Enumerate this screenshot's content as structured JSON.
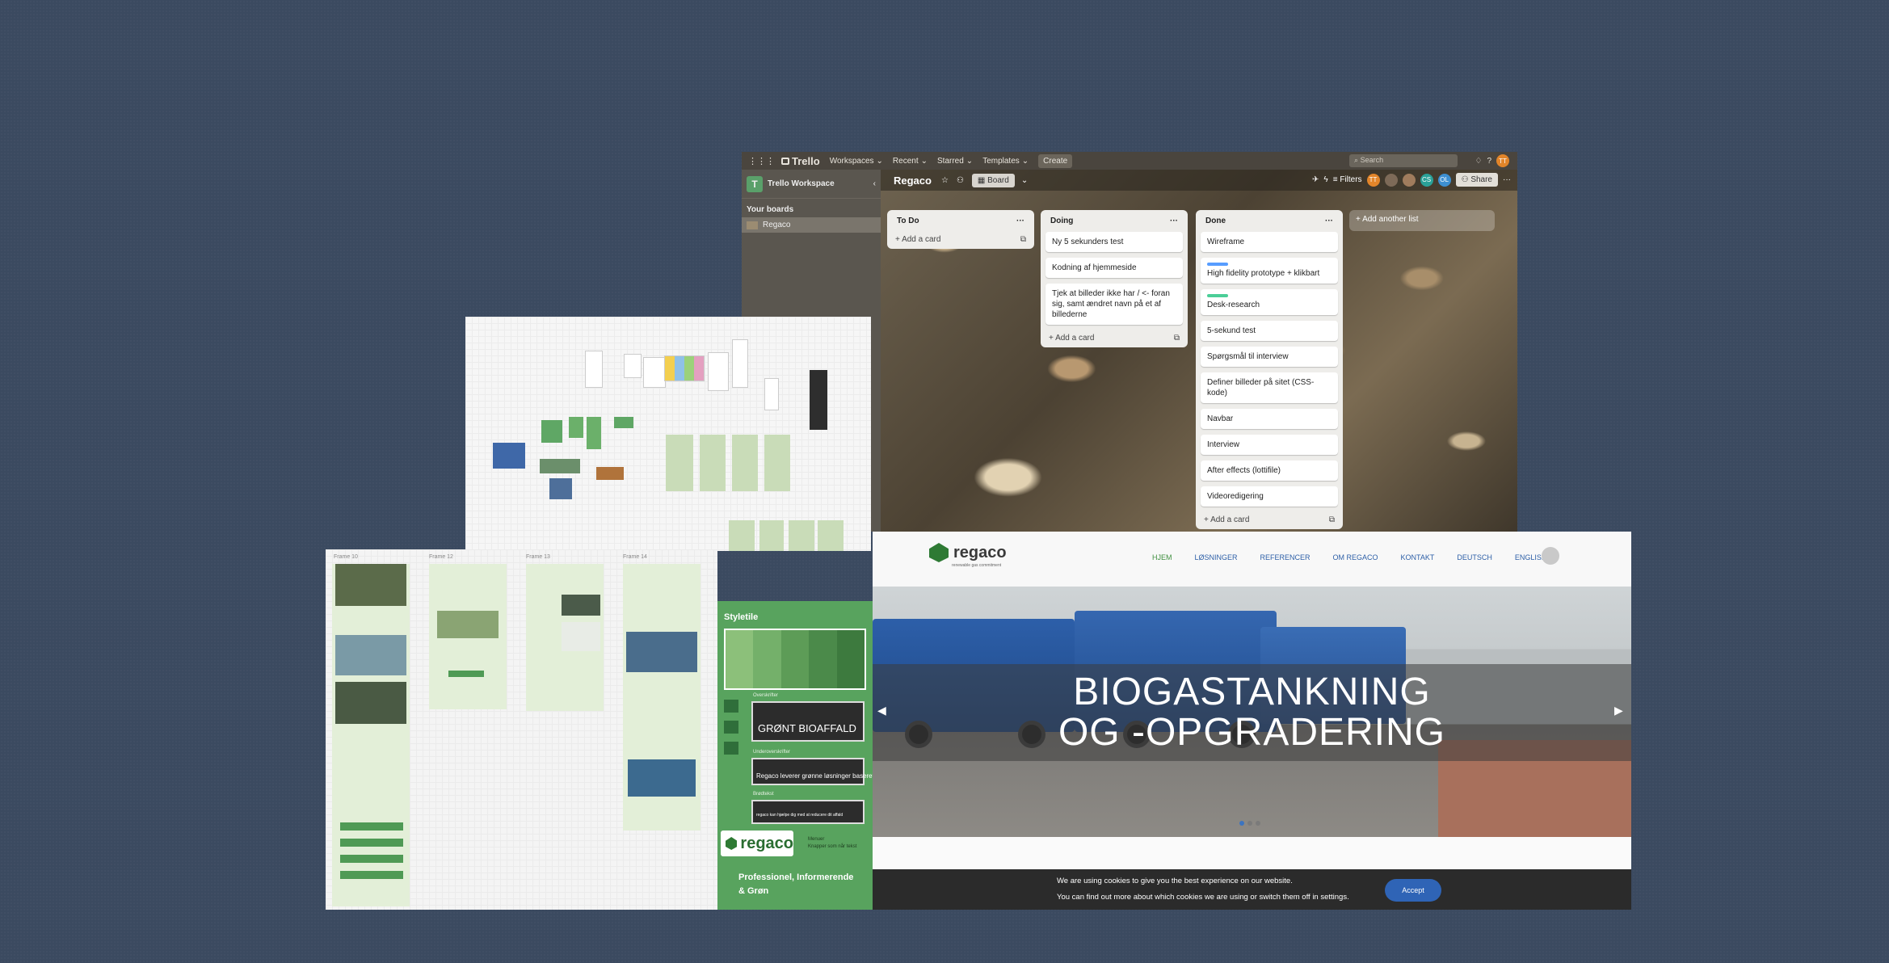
{
  "trello": {
    "app_name": "Trello",
    "nav": {
      "workspaces": "Workspaces",
      "recent": "Recent",
      "starred": "Starred",
      "templates": "Templates",
      "create": "Create"
    },
    "search_placeholder": "Search",
    "user_initials": "TT",
    "sidebar": {
      "workspace_initial": "T",
      "workspace_name": "Trello Workspace",
      "your_boards": "Your boards",
      "board_item": "Regaco"
    },
    "board": {
      "name": "Regaco",
      "view": "Board",
      "filters": "Filters",
      "share": "Share",
      "members": [
        "TT",
        "CS",
        "OL"
      ]
    },
    "lists": [
      {
        "title": "To Do",
        "cards": [],
        "add_card": "Add a card"
      },
      {
        "title": "Doing",
        "cards": [
          "Ny 5 sekunders test",
          "Kodning af hjemmeside",
          "Tjek at billeder ikke har / <- foran sig, samt ændret navn på et af billederne"
        ],
        "add_card": "Add a card"
      },
      {
        "title": "Done",
        "cards": [
          "Wireframe",
          "High fidelity prototype + klikbart",
          "Desk-research",
          "5-sekund test",
          "Spørgsmål til interview",
          "Definer billeder på sitet (CSS-kode)",
          "Navbar",
          "Interview",
          "After effects (lottifile)",
          "Videoredigering"
        ],
        "add_card": "Add a card"
      }
    ],
    "add_list": "Add another list",
    "colors": {
      "label_blue": "#579dff",
      "label_green": "#4bce97",
      "workspace_green": "#5aa06a"
    }
  },
  "styletile": {
    "title": "Styletile",
    "swatch_colors": [
      "#8cc07a",
      "#74b06a",
      "#5d9c57",
      "#4b8a4a",
      "#3d7a3e"
    ],
    "overskrifter_label": "Overskrifter",
    "headline_sample": "GRØNT BIOAFFALD",
    "underoverskrifter_label": "Underoverskrifter",
    "sub_sample": "Regaco leverer grønne løsninger baseret",
    "brodtekst_label": "Brødtekst",
    "body_sample": "regaco kan hjælpe dig med at reducere dit affald",
    "logo_text": "regaco",
    "side_text": [
      "Menuer",
      "Knapper som når tekst"
    ],
    "tagline": [
      "Professionel, Informerende",
      "& Grøn"
    ]
  },
  "frames": {
    "labels": [
      "Frame 10",
      "Frame 12",
      "Frame 13",
      "Frame 14"
    ]
  },
  "site": {
    "brand": "regaco",
    "brand_sub": "renewable gas commitment",
    "menu": [
      "HJEM",
      "LØSNINGER",
      "REFERENCER",
      "OM REGACO",
      "KONTAKT",
      "DEUTSCH",
      "ENGLISH"
    ],
    "hero_line1": "BIOGASTANKNING",
    "hero_line2": "OG -OPGRADERING",
    "cookie_line1": "We are using cookies to give you the best experience on our website.",
    "cookie_line2": "You can find out more about which cookies we are using or switch them off in settings.",
    "accept": "Accept",
    "colors": {
      "menu_blue": "#2d5fa7",
      "menu_active": "#3f8f3f",
      "accept_blue": "#2f64b6"
    }
  }
}
